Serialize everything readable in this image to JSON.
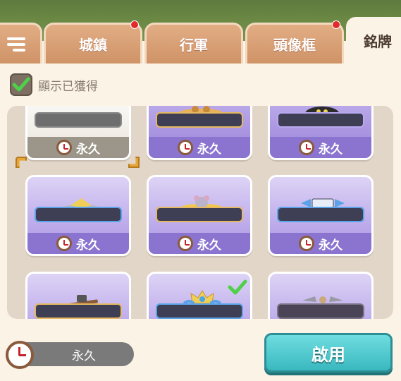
{
  "tabs": [
    {
      "label": "",
      "icon": "list-menu-icon",
      "active": false
    },
    {
      "label": "城鎮",
      "badge": true,
      "active": false
    },
    {
      "label": "行軍",
      "badge": false,
      "active": false
    },
    {
      "label": "頭像框",
      "badge": true,
      "active": false
    },
    {
      "label": "銘牌",
      "badge": false,
      "active": true
    }
  ],
  "filter": {
    "label": "顯示已獲得",
    "checked": true
  },
  "cards": [
    {
      "duration": "永久",
      "style": "gray",
      "selected": true
    },
    {
      "duration": "永久",
      "style": "purple"
    },
    {
      "duration": "永久",
      "style": "purple"
    },
    {
      "duration": "永久",
      "style": "light"
    },
    {
      "duration": "永久",
      "style": "light"
    },
    {
      "duration": "永久",
      "style": "light"
    },
    {
      "duration": "",
      "style": "light"
    },
    {
      "duration": "",
      "style": "light",
      "owned_check": true
    },
    {
      "duration": "",
      "style": "light"
    }
  ],
  "bottom": {
    "duration": "永久",
    "enable_label": "啟用"
  },
  "colors": {
    "accent": "#39b8bf",
    "tab": "#cf9367",
    "badge": "#e12a2a",
    "card": "#a893e0"
  }
}
